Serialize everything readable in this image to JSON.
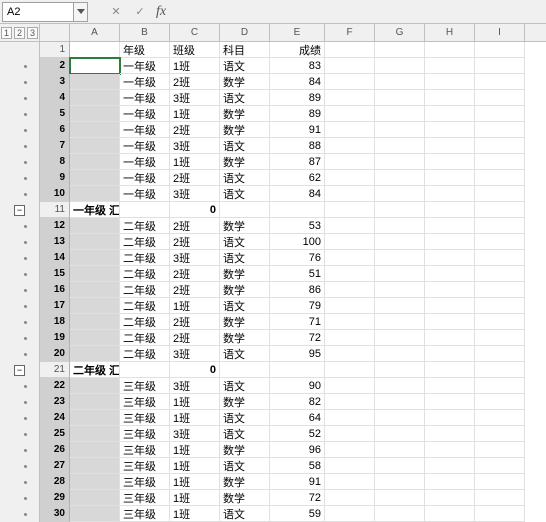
{
  "nameBox": "A2",
  "formulaBar": "",
  "outlineLevels": [
    "1",
    "2",
    "3"
  ],
  "columns": [
    "A",
    "B",
    "C",
    "D",
    "E",
    "F",
    "G",
    "H",
    "I"
  ],
  "headerRow": {
    "b": "年级",
    "c": "班级",
    "d": "科目",
    "e": "成绩"
  },
  "groups": [
    {
      "summary": {
        "row": 11,
        "a": "一年级 汇",
        "c": 0
      },
      "rows": [
        {
          "n": 2,
          "b": "一年级",
          "c": "1班",
          "d": "语文",
          "e": 83
        },
        {
          "n": 3,
          "b": "一年级",
          "c": "2班",
          "d": "数学",
          "e": 84
        },
        {
          "n": 4,
          "b": "一年级",
          "c": "3班",
          "d": "语文",
          "e": 89
        },
        {
          "n": 5,
          "b": "一年级",
          "c": "1班",
          "d": "数学",
          "e": 89
        },
        {
          "n": 6,
          "b": "一年级",
          "c": "2班",
          "d": "数学",
          "e": 91
        },
        {
          "n": 7,
          "b": "一年级",
          "c": "3班",
          "d": "语文",
          "e": 88
        },
        {
          "n": 8,
          "b": "一年级",
          "c": "1班",
          "d": "数学",
          "e": 87
        },
        {
          "n": 9,
          "b": "一年级",
          "c": "2班",
          "d": "语文",
          "e": 62
        },
        {
          "n": 10,
          "b": "一年级",
          "c": "3班",
          "d": "语文",
          "e": 84
        }
      ]
    },
    {
      "summary": {
        "row": 21,
        "a": "二年级 汇",
        "c": 0
      },
      "rows": [
        {
          "n": 12,
          "b": "二年级",
          "c": "2班",
          "d": "数学",
          "e": 53
        },
        {
          "n": 13,
          "b": "二年级",
          "c": "2班",
          "d": "语文",
          "e": 100
        },
        {
          "n": 14,
          "b": "二年级",
          "c": "3班",
          "d": "语文",
          "e": 76
        },
        {
          "n": 15,
          "b": "二年级",
          "c": "2班",
          "d": "数学",
          "e": 51
        },
        {
          "n": 16,
          "b": "二年级",
          "c": "2班",
          "d": "数学",
          "e": 86
        },
        {
          "n": 17,
          "b": "二年级",
          "c": "1班",
          "d": "语文",
          "e": 79
        },
        {
          "n": 18,
          "b": "二年级",
          "c": "2班",
          "d": "数学",
          "e": 71
        },
        {
          "n": 19,
          "b": "二年级",
          "c": "2班",
          "d": "数学",
          "e": 72
        },
        {
          "n": 20,
          "b": "二年级",
          "c": "3班",
          "d": "语文",
          "e": 95
        }
      ]
    },
    {
      "summary": null,
      "rows": [
        {
          "n": 22,
          "b": "三年级",
          "c": "3班",
          "d": "语文",
          "e": 90
        },
        {
          "n": 23,
          "b": "三年级",
          "c": "1班",
          "d": "数学",
          "e": 82
        },
        {
          "n": 24,
          "b": "三年级",
          "c": "1班",
          "d": "语文",
          "e": 64
        },
        {
          "n": 25,
          "b": "三年级",
          "c": "3班",
          "d": "语文",
          "e": 52
        },
        {
          "n": 26,
          "b": "三年级",
          "c": "1班",
          "d": "数学",
          "e": 96
        },
        {
          "n": 27,
          "b": "三年级",
          "c": "1班",
          "d": "语文",
          "e": 58
        },
        {
          "n": 28,
          "b": "三年级",
          "c": "1班",
          "d": "数学",
          "e": 91
        },
        {
          "n": 29,
          "b": "三年级",
          "c": "1班",
          "d": "数学",
          "e": 72
        },
        {
          "n": 30,
          "b": "三年级",
          "c": "1班",
          "d": "语文",
          "e": 59
        }
      ]
    }
  ],
  "chart_data": {
    "type": "table",
    "columns": [
      "年级",
      "班级",
      "科目",
      "成绩"
    ],
    "rows": [
      [
        "一年级",
        "1班",
        "语文",
        83
      ],
      [
        "一年级",
        "2班",
        "数学",
        84
      ],
      [
        "一年级",
        "3班",
        "语文",
        89
      ],
      [
        "一年级",
        "1班",
        "数学",
        89
      ],
      [
        "一年级",
        "2班",
        "数学",
        91
      ],
      [
        "一年级",
        "3班",
        "语文",
        88
      ],
      [
        "一年级",
        "1班",
        "数学",
        87
      ],
      [
        "一年级",
        "2班",
        "语文",
        62
      ],
      [
        "一年级",
        "3班",
        "语文",
        84
      ],
      [
        "二年级",
        "2班",
        "数学",
        53
      ],
      [
        "二年级",
        "2班",
        "语文",
        100
      ],
      [
        "二年级",
        "3班",
        "语文",
        76
      ],
      [
        "二年级",
        "2班",
        "数学",
        51
      ],
      [
        "二年级",
        "2班",
        "数学",
        86
      ],
      [
        "二年级",
        "1班",
        "语文",
        79
      ],
      [
        "二年级",
        "2班",
        "数学",
        71
      ],
      [
        "二年级",
        "2班",
        "数学",
        72
      ],
      [
        "二年级",
        "3班",
        "语文",
        95
      ],
      [
        "三年级",
        "3班",
        "语文",
        90
      ],
      [
        "三年级",
        "1班",
        "数学",
        82
      ],
      [
        "三年级",
        "1班",
        "语文",
        64
      ],
      [
        "三年级",
        "3班",
        "语文",
        52
      ],
      [
        "三年级",
        "1班",
        "数学",
        96
      ],
      [
        "三年级",
        "1班",
        "语文",
        58
      ],
      [
        "三年级",
        "1班",
        "数学",
        91
      ],
      [
        "三年级",
        "1班",
        "数学",
        72
      ],
      [
        "三年级",
        "1班",
        "语文",
        59
      ]
    ],
    "subtotals": [
      {
        "label": "一年级 汇",
        "value": 0
      },
      {
        "label": "二年级 汇",
        "value": 0
      }
    ]
  }
}
